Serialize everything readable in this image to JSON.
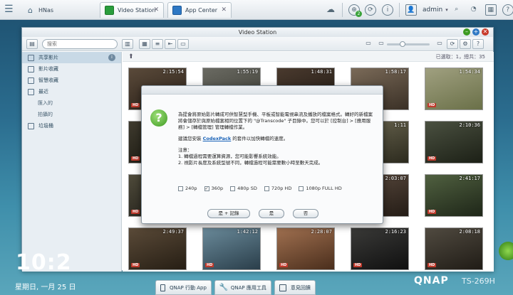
{
  "taskbar": {
    "home_tab": "HNas",
    "tabs": [
      {
        "label": "Video Station",
        "color": "#2a9d3c"
      },
      {
        "label": "App Center",
        "color": "#2e78c4"
      }
    ],
    "notification_badge": "2",
    "user": "admin"
  },
  "window": {
    "title": "Video Station",
    "search_placeholder": "搜索",
    "sidebar": [
      {
        "label": "共享影片",
        "active": true,
        "sub": false,
        "badge": "i"
      },
      {
        "label": "影片收藏",
        "active": false,
        "sub": false
      },
      {
        "label": "智慧收藏",
        "active": false,
        "sub": false
      },
      {
        "label": "最近",
        "active": false,
        "sub": false
      },
      {
        "label": "匯入的",
        "active": false,
        "sub": true
      },
      {
        "label": "拍攝的",
        "active": false,
        "sub": true
      },
      {
        "label": "垃圾桶",
        "active": false,
        "sub": false
      }
    ],
    "selected_count": "已選取：1，總共：35",
    "thumbnails": [
      {
        "dur": "2:15:54",
        "hd": true,
        "c1": "#5a4a3a",
        "c2": "#2a2018"
      },
      {
        "dur": "1:55:19",
        "hd": false,
        "c1": "#6a6a62",
        "c2": "#3a3a32"
      },
      {
        "dur": "1:48:31",
        "hd": true,
        "c1": "#4a3a2e",
        "c2": "#1e1812"
      },
      {
        "dur": "1:58:17",
        "hd": true,
        "c1": "#7a6a58",
        "c2": "#3a3026"
      },
      {
        "dur": "1:54:34",
        "hd": true,
        "c1": "#a0a080",
        "c2": "#6a7048"
      },
      {
        "dur": "",
        "hd": true,
        "c1": "#3e3a2e",
        "c2": "#1a1810"
      },
      {
        "dur": "",
        "hd": false,
        "c1": "#5a5040",
        "c2": "#2a241c"
      },
      {
        "dur": "",
        "hd": true,
        "c1": "#3a3a30",
        "c2": "#141410"
      },
      {
        "dur": "1:11",
        "hd": true,
        "c1": "#6a6650",
        "c2": "#2c2a1e"
      },
      {
        "dur": "2:10:36",
        "hd": true,
        "c1": "#4a5040",
        "c2": "#1c2016"
      },
      {
        "dur": "",
        "hd": true,
        "c1": "#4e4a3a",
        "c2": "#22201a"
      },
      {
        "dur": "",
        "hd": false,
        "c1": "#6a5a4a",
        "c2": "#302820"
      },
      {
        "dur": "",
        "hd": true,
        "c1": "#3e3630",
        "c2": "#181410"
      },
      {
        "dur": "2:03:07",
        "hd": true,
        "c1": "#5a4a3e",
        "c2": "#241c16"
      },
      {
        "dur": "2:41:17",
        "hd": true,
        "c1": "#506040",
        "c2": "#1e2618"
      },
      {
        "dur": "2:49:37",
        "hd": true,
        "c1": "#5a4a38",
        "c2": "#261e14"
      },
      {
        "dur": "1:42:12",
        "hd": true,
        "c1": "#6a8a9a",
        "c2": "#2a3e4a"
      },
      {
        "dur": "2:28:07",
        "hd": true,
        "c1": "#a07050",
        "c2": "#4a2e1c"
      },
      {
        "dur": "2:16:23",
        "hd": true,
        "c1": "#3a3a38",
        "c2": "#101010"
      },
      {
        "dur": "2:08:18",
        "hd": true,
        "c1": "#504a40",
        "c2": "#201c16"
      }
    ]
  },
  "dialog": {
    "paragraph1": "為提會將原始影片轉成可供智慧型手機、平板或智能電視串流及播放的檔案格式。轉好的新檔案將會儲存於與原始檔案相同位置下的 \"@Transcode\" 子目錄中。您可以於 [控制台] > [應用服務] > [轉檔管理] 管理轉檔作業。",
    "paragraph2_pre": "建議您安裝 ",
    "paragraph2_link": "CodexPack",
    "paragraph2_post": " 的套件以加快轉檔的速度。",
    "note_title": "注意：",
    "note1": "1. 轉檔過程需要運算資源，您可能影響系統效能。",
    "note2": "2. 視影片長度及系統型號不同，轉檔過程可能需要數小時至數天完成。",
    "options": [
      {
        "label": "240p",
        "checked": false
      },
      {
        "label": "360p",
        "checked": true
      },
      {
        "label": "480p SD",
        "checked": false
      },
      {
        "label": "720p HD",
        "checked": false
      },
      {
        "label": "1080p FULL HD",
        "checked": false
      }
    ],
    "btn_yes_remember": "是 + 記錄",
    "btn_yes": "是",
    "btn_no": "否"
  },
  "desktop": {
    "clock": "10:2",
    "date": "星期日, 一月 25 日",
    "dock": [
      "QNAP 行動 App",
      "QNAP 應用工具",
      "意見回饋"
    ],
    "brand": "QNAP",
    "model": "TS-269H"
  }
}
